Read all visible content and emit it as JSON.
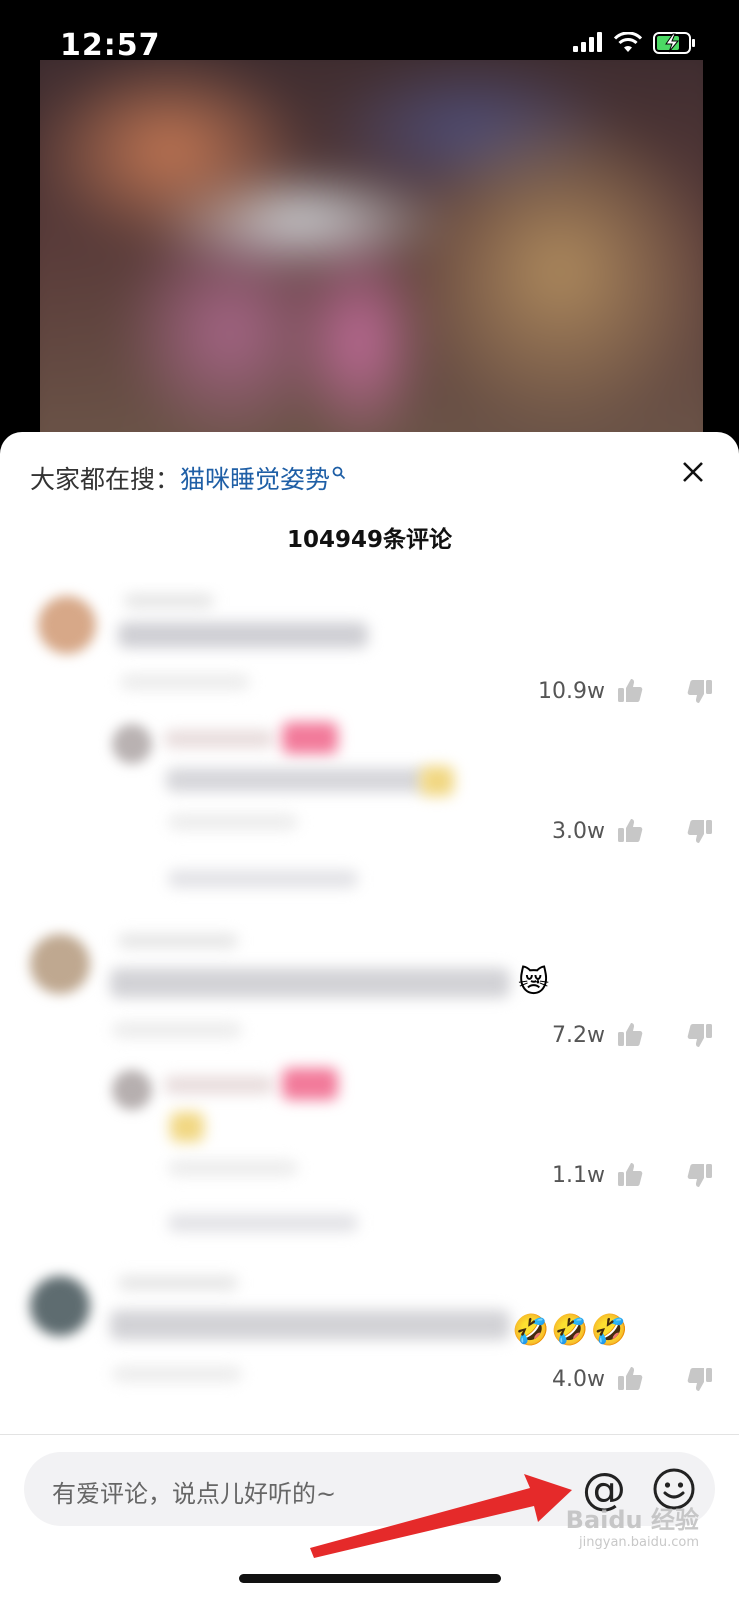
{
  "status_bar": {
    "time": "12:57",
    "battery_color": "#4cd964"
  },
  "search_hint": {
    "prefix": "大家都在搜：",
    "keyword": "猫咪睡觉姿势"
  },
  "comments_header": {
    "count_text": "104949条评论"
  },
  "comments": [
    {
      "likes": "10.9w"
    },
    {
      "likes": "3.0w"
    },
    {
      "likes": "7.2w",
      "emoji": "😿"
    },
    {
      "likes": "1.1w"
    },
    {
      "likes": "4.0w",
      "emoji": "🤣🤣🤣"
    }
  ],
  "input_bar": {
    "placeholder": "有爱评论，说点儿好听的~",
    "at_label": "@"
  },
  "watermark": {
    "text": "Baidu 经验",
    "sub": "jingyan.baidu.com"
  },
  "colors": {
    "keyword_link": "#1f5fa6",
    "arrow": "#e52a2a"
  }
}
